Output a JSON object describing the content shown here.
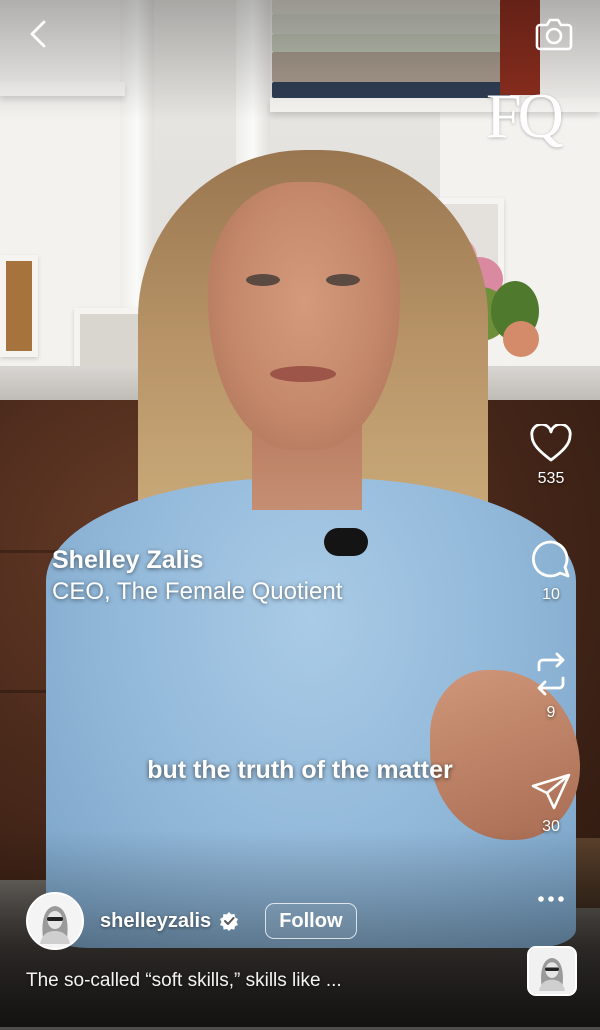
{
  "top_bar": {
    "back_icon": "chevron-left-icon",
    "camera_icon": "camera-icon",
    "brand_logo": "FQ"
  },
  "actions": {
    "like": {
      "icon": "heart-icon",
      "count": "535"
    },
    "comment": {
      "icon": "comment-bubble-icon",
      "count": "10"
    },
    "remix": {
      "icon": "repost-icon",
      "count": "9"
    },
    "share": {
      "icon": "paper-plane-icon",
      "count": "30"
    },
    "more": {
      "icon": "more-dots-icon"
    }
  },
  "video": {
    "speaker_name": "Shelley Zalis",
    "speaker_title": "CEO, The Female Quotient",
    "subtitle": "but the truth of the matter"
  },
  "author": {
    "username": "shelleyzalis",
    "verified": true,
    "follow_label": "Follow"
  },
  "description": "The so-called “soft skills,” skills like ...",
  "colors": {
    "text": "#ffffff",
    "sweater": "#93b9da",
    "chair": "#4b2a1b"
  }
}
